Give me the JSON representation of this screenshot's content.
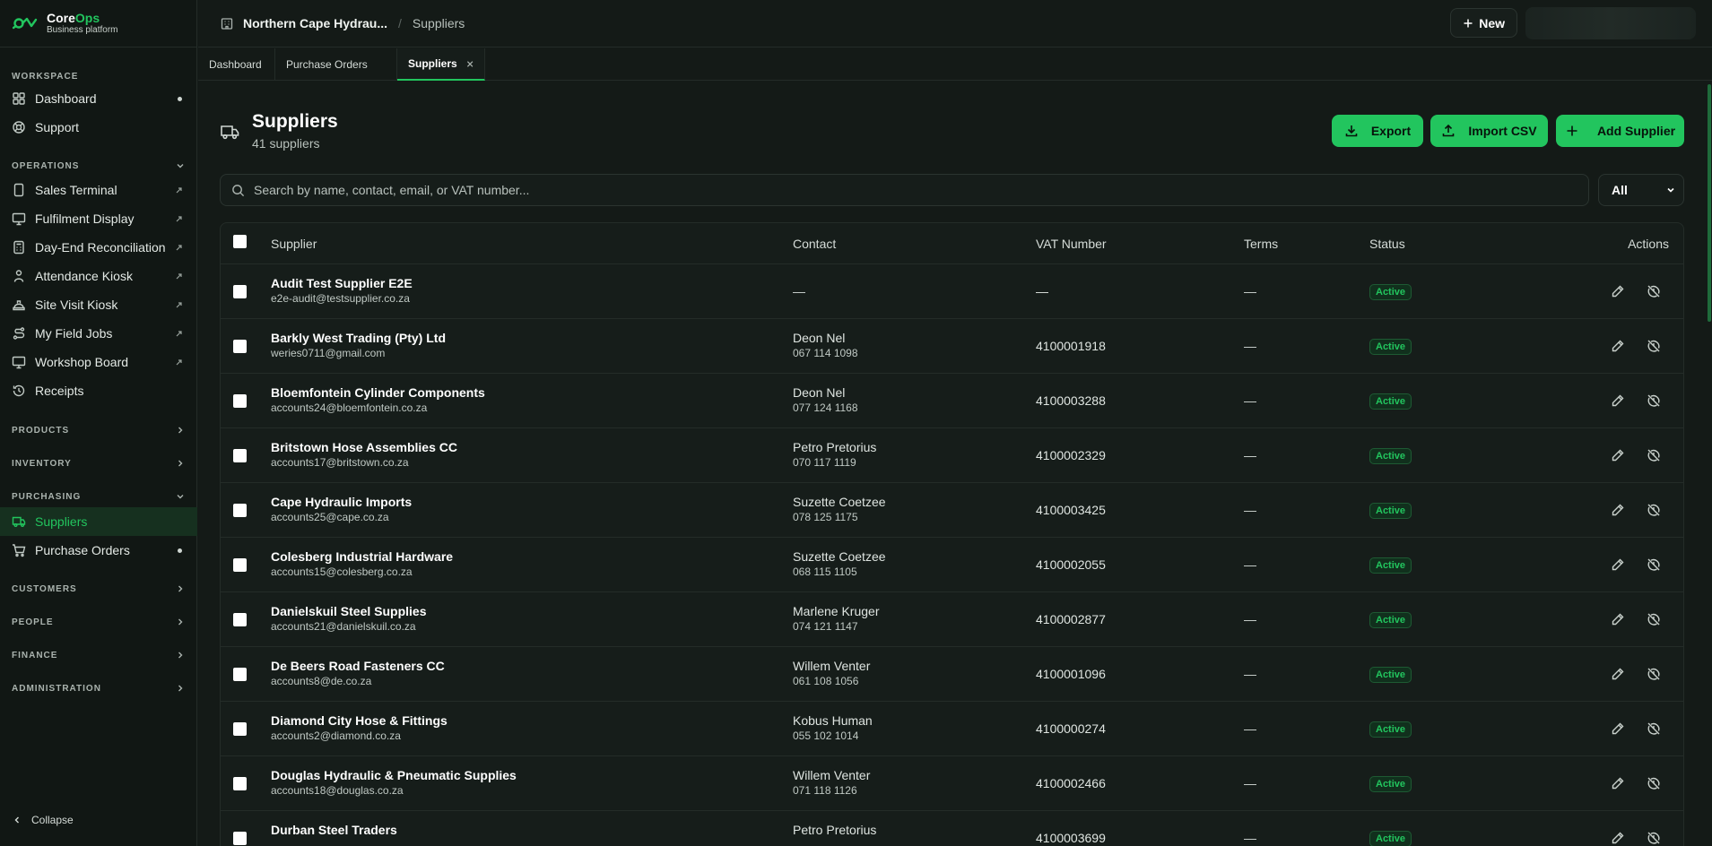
{
  "brand": {
    "name_a": "Core",
    "name_b": "Ops",
    "subtitle": "Business platform"
  },
  "sidebar": {
    "workspace_label": "WORKSPACE",
    "workspace_items": [
      {
        "label": "Dashboard",
        "icon": "grid-icon",
        "badge": "dot"
      },
      {
        "label": "Support",
        "icon": "lifebuoy-icon"
      }
    ],
    "operations_label": "OPERATIONS",
    "operations_items": [
      {
        "label": "Sales Terminal",
        "icon": "tablet-icon"
      },
      {
        "label": "Fulfilment Display",
        "icon": "monitor-icon"
      },
      {
        "label": "Day-End Reconciliation",
        "icon": "calculator-icon"
      },
      {
        "label": "Attendance Kiosk",
        "icon": "person-icon"
      },
      {
        "label": "Site Visit Kiosk",
        "icon": "hardhat-icon"
      },
      {
        "label": "My Field Jobs",
        "icon": "route-icon"
      },
      {
        "label": "Workshop Board",
        "icon": "monitor-icon"
      },
      {
        "label": "Receipts",
        "icon": "history-icon"
      }
    ],
    "products_label": "PRODUCTS",
    "inventory_label": "INVENTORY",
    "purchasing_label": "PURCHASING",
    "purchasing_items": [
      {
        "label": "Suppliers",
        "icon": "truck-icon",
        "active": true
      },
      {
        "label": "Purchase Orders",
        "icon": "cart-icon",
        "badge": "dot"
      }
    ],
    "customers_label": "CUSTOMERS",
    "people_label": "PEOPLE",
    "finance_label": "FINANCE",
    "administration_label": "ADMINISTRATION",
    "collapse_label": "Collapse"
  },
  "topbar": {
    "org": "Northern Cape Hydrau...",
    "page": "Suppliers",
    "new_label": "New"
  },
  "tabs": [
    {
      "label": "Dashboard",
      "closable": true
    },
    {
      "label": "Purchase Orders",
      "closable": false
    },
    {
      "label": "Suppliers",
      "closable": true,
      "active": true
    }
  ],
  "page": {
    "title": "Suppliers",
    "subtitle": "41 suppliers",
    "export_label": "Export",
    "import_label": "Import CSV",
    "add_label": "Add Supplier"
  },
  "search": {
    "placeholder": "Search by name, contact, email, or VAT number...",
    "filter_value": "All"
  },
  "table": {
    "headers": {
      "supplier": "Supplier",
      "contact": "Contact",
      "vat": "VAT Number",
      "terms": "Terms",
      "status": "Status",
      "actions": "Actions"
    },
    "rows": [
      {
        "name": "Audit Test Supplier E2E",
        "email": "e2e-audit@testsupplier.co.za",
        "contact": "",
        "phone": "",
        "vat": "—",
        "terms": "—",
        "status": "Active"
      },
      {
        "name": "Barkly West Trading (Pty) Ltd",
        "email": "weries0711@gmail.com",
        "contact": "Deon Nel",
        "phone": "067 114 1098",
        "vat": "4100001918",
        "terms": "—",
        "status": "Active"
      },
      {
        "name": "Bloemfontein Cylinder Components",
        "email": "accounts24@bloemfontein.co.za",
        "contact": "Deon Nel",
        "phone": "077 124 1168",
        "vat": "4100003288",
        "terms": "—",
        "status": "Active"
      },
      {
        "name": "Britstown Hose Assemblies CC",
        "email": "accounts17@britstown.co.za",
        "contact": "Petro Pretorius",
        "phone": "070 117 1119",
        "vat": "4100002329",
        "terms": "—",
        "status": "Active"
      },
      {
        "name": "Cape Hydraulic Imports",
        "email": "accounts25@cape.co.za",
        "contact": "Suzette Coetzee",
        "phone": "078 125 1175",
        "vat": "4100003425",
        "terms": "—",
        "status": "Active"
      },
      {
        "name": "Colesberg Industrial Hardware",
        "email": "accounts15@colesberg.co.za",
        "contact": "Suzette Coetzee",
        "phone": "068 115 1105",
        "vat": "4100002055",
        "terms": "—",
        "status": "Active"
      },
      {
        "name": "Danielskuil Steel Supplies",
        "email": "accounts21@danielskuil.co.za",
        "contact": "Marlene Kruger",
        "phone": "074 121 1147",
        "vat": "4100002877",
        "terms": "—",
        "status": "Active"
      },
      {
        "name": "De Beers Road Fasteners CC",
        "email": "accounts8@de.co.za",
        "contact": "Willem Venter",
        "phone": "061 108 1056",
        "vat": "4100001096",
        "terms": "—",
        "status": "Active"
      },
      {
        "name": "Diamond City Hose & Fittings",
        "email": "accounts2@diamond.co.za",
        "contact": "Kobus Human",
        "phone": "055 102 1014",
        "vat": "4100000274",
        "terms": "—",
        "status": "Active"
      },
      {
        "name": "Douglas Hydraulic & Pneumatic Supplies",
        "email": "accounts18@douglas.co.za",
        "contact": "Willem Venter",
        "phone": "071 118 1126",
        "vat": "4100002466",
        "terms": "—",
        "status": "Active"
      },
      {
        "name": "Durban Steel Traders",
        "email": "",
        "contact": "Petro Pretorius",
        "phone": "",
        "vat": "4100003699",
        "terms": "—",
        "status": "Active"
      }
    ]
  },
  "colors": {
    "accent": "#22c55e",
    "background": "#141a17",
    "sidebar": "#111714"
  }
}
